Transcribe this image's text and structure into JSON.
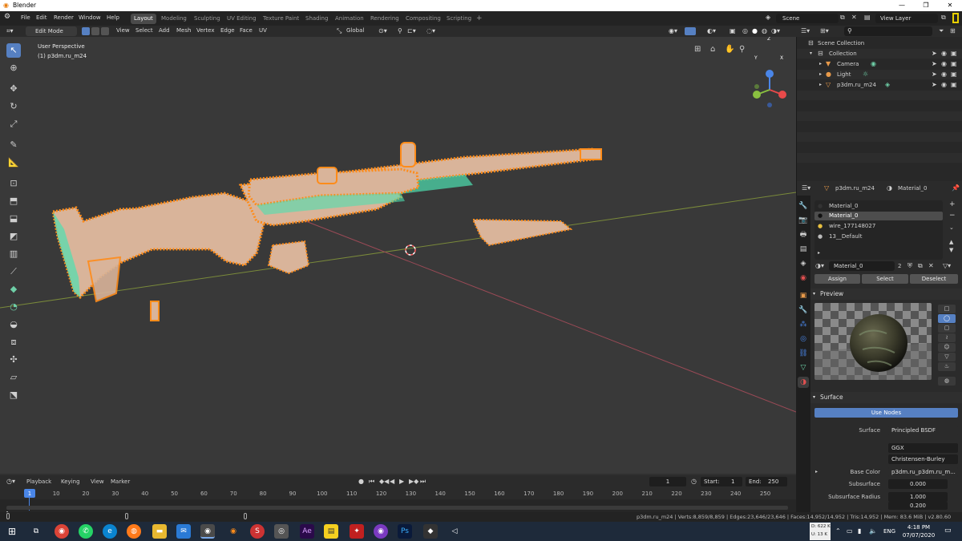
{
  "window": {
    "title": "Blender",
    "minimize": "—",
    "maximize": "❐",
    "close": "✕"
  },
  "menu": [
    "File",
    "Edit",
    "Render",
    "Window",
    "Help"
  ],
  "workspaces": [
    "Layout",
    "Modeling",
    "Sculpting",
    "UV Editing",
    "Texture Paint",
    "Shading",
    "Animation",
    "Rendering",
    "Compositing",
    "Scripting",
    "+"
  ],
  "active_workspace": "Layout",
  "scene": {
    "name": "Scene",
    "view_layer": "View Layer"
  },
  "viewport_header": {
    "mode": "Edit Mode",
    "menus": [
      "View",
      "Select",
      "Add",
      "Mesh",
      "Vertex",
      "Edge",
      "Face",
      "UV"
    ],
    "orientation": "Global"
  },
  "viewport": {
    "perspective": "User Perspective",
    "object_label": "(1) p3dm.ru_m24",
    "gizmo_x": "X",
    "gizmo_y": "Y",
    "gizmo_z": "Z"
  },
  "outliner": {
    "root": "Scene Collection",
    "items": [
      {
        "name": "Collection",
        "depth": 1
      },
      {
        "name": "Camera",
        "depth": 2
      },
      {
        "name": "Light",
        "depth": 2
      },
      {
        "name": "p3dm.ru_m24",
        "depth": 2
      }
    ]
  },
  "properties": {
    "object": "p3dm.ru_m24",
    "material": "Material_0",
    "slots": [
      "Material_0",
      "Material_0",
      "wire_177148027",
      "13__Default"
    ],
    "active_slot": 1,
    "material_name": "Material_0",
    "users": "2",
    "assign": "Assign",
    "select": "Select",
    "deselect": "Deselect",
    "preview_title": "Preview",
    "surface_title": "Surface",
    "use_nodes": "Use Nodes",
    "surface_label": "Surface",
    "surface_value": "Principled BSDF",
    "distribution": "GGX",
    "subsurface_method": "Christensen-Burley",
    "base_color_label": "Base Color",
    "base_color_value": "p3dm.ru_p3dm.ru_m...",
    "subsurface_label": "Subsurface",
    "subsurface_value": "0.000",
    "subsurface_radius_label": "Subsurface Radius",
    "subsurface_radius_1": "1.000",
    "subsurface_radius_2": "0.200"
  },
  "timeline": {
    "menus": [
      "Playback",
      "Keying",
      "View",
      "Marker"
    ],
    "current_frame": "1",
    "start_label": "Start:",
    "start": "1",
    "end_label": "End:",
    "end": "250",
    "ticks": [
      "1",
      "10",
      "20",
      "30",
      "40",
      "50",
      "60",
      "70",
      "80",
      "90",
      "100",
      "110",
      "120",
      "130",
      "140",
      "150",
      "160",
      "170",
      "180",
      "190",
      "200",
      "210",
      "220",
      "230",
      "240",
      "250"
    ]
  },
  "status": "p3dm.ru_m24 | Verts:8,859/8,859 | Edges:23,646/23,646 | Faces:14,952/14,952 | Tris:14,952 | Mem: 83.6 MiB | v2.80.60",
  "taskbar": {
    "net_down": "D: 622 K",
    "net_up": "U: 13 K",
    "lang": "ENG",
    "time": "4:18 PM",
    "date": "07/07/2020"
  },
  "colors": {
    "accent": "#5680c2",
    "selected": "#ff8c1a",
    "weapon": "#d9b49a",
    "edge": "#4de0b0",
    "bg": "#393939"
  }
}
